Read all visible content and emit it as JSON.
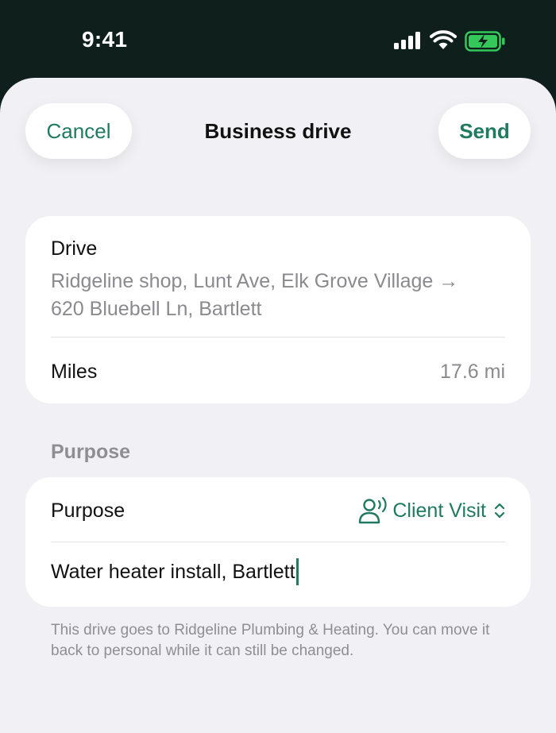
{
  "status_bar": {
    "time": "9:41",
    "icons": [
      "cellular-signal-icon",
      "wifi-icon",
      "battery-charging-icon"
    ],
    "battery_color": "#34c759"
  },
  "nav": {
    "cancel_label": "Cancel",
    "title": "Business drive",
    "send_label": "Send"
  },
  "drive_card": {
    "drive_label": "Drive",
    "route_line1": "Ridgeline shop, Lunt Ave, Elk Grove Village →",
    "route_line2": "620 Bluebell Ln, Bartlett",
    "miles_label": "Miles",
    "miles_value": "17.6 mi"
  },
  "purpose_section": {
    "header": "Purpose",
    "purpose_label": "Purpose",
    "selected_purpose": "Client Visit",
    "purpose_icon": "client-person-icon",
    "note_value": "Water heater install, Bartlett"
  },
  "footnote": "This drive goes to Ridgeline Plumbing & Heating. You can move it back to personal while it can still be changed.",
  "colors": {
    "accent": "#1f7a60",
    "sheet_background": "#f1f1f5",
    "status_bar_background": "#0f1f1c",
    "secondary_text": "#8a8a8f"
  }
}
